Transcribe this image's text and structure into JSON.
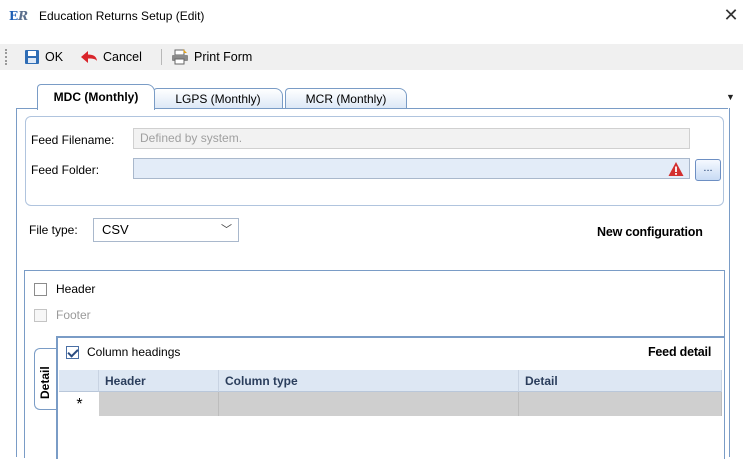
{
  "window": {
    "logo": "ER",
    "title": "Education Returns Setup (Edit)",
    "close_glyph": "✕"
  },
  "toolbar": {
    "ok_label": "OK",
    "cancel_label": "Cancel",
    "print_label": "Print Form",
    "icons": {
      "ok": "save-icon",
      "cancel": "back-arrow-icon",
      "print": "print-icon"
    }
  },
  "tabs": [
    {
      "label": "MDC (Monthly)",
      "active": true
    },
    {
      "label": "LGPS (Monthly)",
      "active": false
    },
    {
      "label": "MCR (Monthly)",
      "active": false
    }
  ],
  "feed": {
    "filename_label": "Feed Filename:",
    "filename_placeholder": "Defined by system.",
    "folder_label": "Feed Folder:",
    "folder_value": "",
    "browse_label": "...",
    "warning_color": "#d32f2f"
  },
  "file_type": {
    "label": "File type:",
    "selected": "CSV"
  },
  "config_status": "New configuration",
  "options": {
    "header_label": "Header",
    "header_checked": false,
    "footer_label": "Footer",
    "footer_checked": false,
    "footer_enabled": false
  },
  "detail": {
    "side_tab_label": "Detail",
    "column_headings_label": "Column headings",
    "column_headings_checked": true,
    "title": "Feed detail",
    "grid": {
      "columns": [
        "Header",
        "Column type",
        "Detail"
      ],
      "new_row_marker": "*"
    }
  },
  "colors": {
    "accent": "#7a9cc6",
    "grid_header_bg": "#dde7f3",
    "new_row_bg": "#cfcfcf"
  }
}
